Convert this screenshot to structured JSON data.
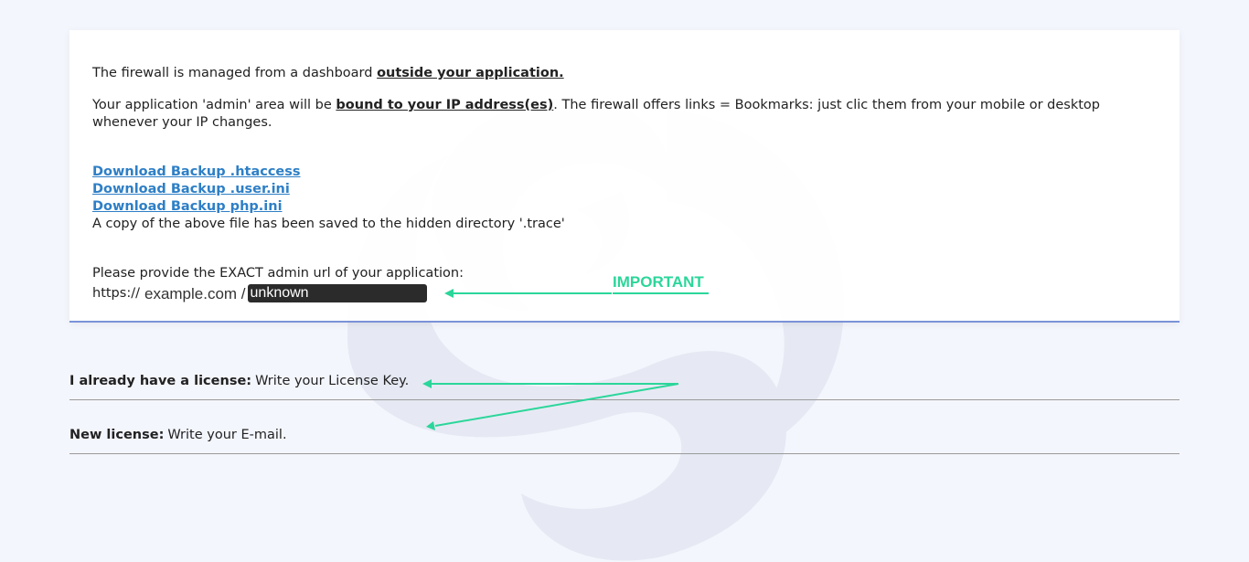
{
  "firewall": {
    "line1_prefix": "The firewall is managed from a dashboard ",
    "line1_bold": "outside your application.",
    "line2_prefix": "Your application 'admin' area will be ",
    "line2_bold": "bound to your IP address(es)",
    "line2_suffix": ". The firewall offers links = Bookmarks: just clic them from your mobile or desktop whenever your IP changes."
  },
  "downloads": [
    {
      "label": "Download Backup .htaccess"
    },
    {
      "label": "Download Backup .user.ini"
    },
    {
      "label": "Download Backup php.ini"
    }
  ],
  "copy_note": "A copy of the above file has been saved to the hidden directory '.trace'",
  "admin_url": {
    "prompt": "Please provide the EXACT admin url of your application:",
    "scheme": "https://",
    "host": "example.com /",
    "value": "unknown"
  },
  "annotation": {
    "important": "IMPORTANT",
    "color": "#2bd69a"
  },
  "license": {
    "existing_bold": "I already have a license:",
    "existing_text": "Write your License Key.",
    "new_bold": "New license:",
    "new_text": "Write your E-mail."
  },
  "colors": {
    "background": "#f4f6fd",
    "link": "#2e7fc6",
    "card_border": "#7a92d8"
  }
}
